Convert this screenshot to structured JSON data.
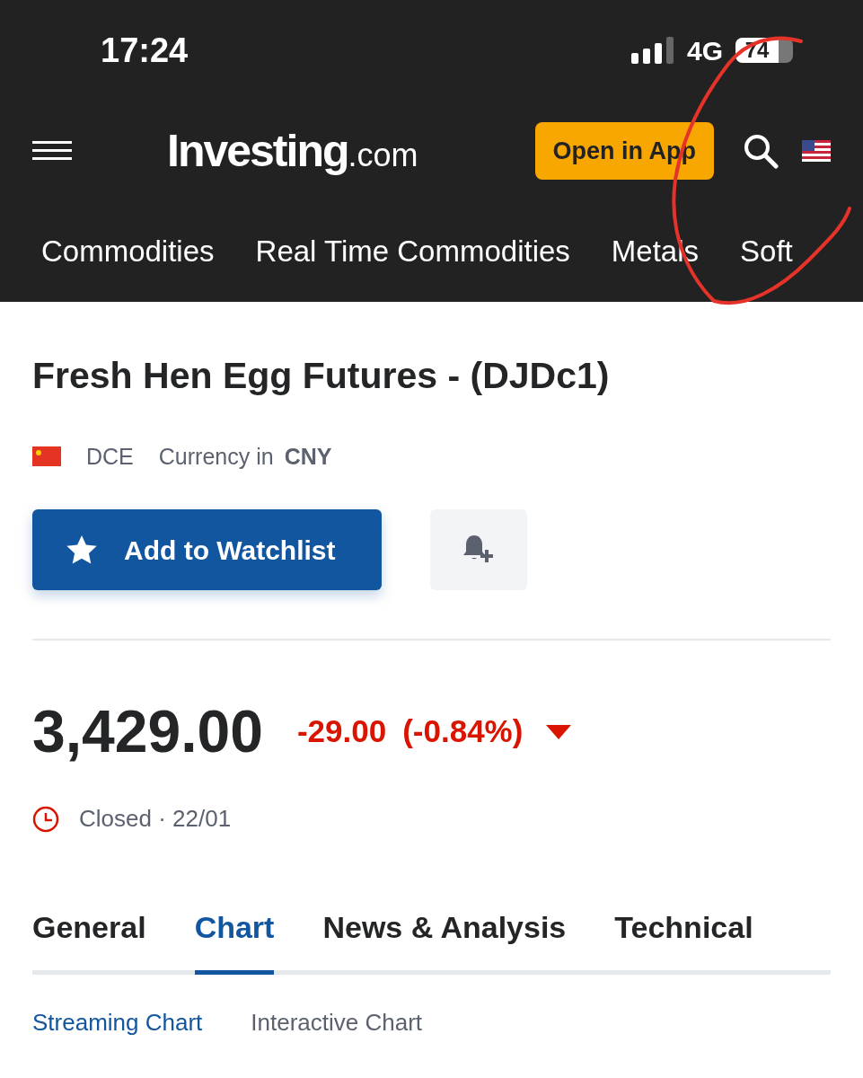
{
  "status_bar": {
    "time": "17:24",
    "network": "4G",
    "battery": "74"
  },
  "header": {
    "logo_main": "Investing",
    "logo_suffix": ".com",
    "open_app_button": "Open in App"
  },
  "nav": [
    {
      "label": "Commodities"
    },
    {
      "label": "Real Time Commodities"
    },
    {
      "label": "Metals"
    },
    {
      "label": "Soft"
    }
  ],
  "instrument": {
    "title": "Fresh Hen Egg Futures - (DJDc1)",
    "exchange": "DCE",
    "currency_label": "Currency in",
    "currency": "CNY"
  },
  "watchlist_button": "Add to Watchlist",
  "quote": {
    "price": "3,429.00",
    "change": "-29.00",
    "change_percent": "(-0.84%)",
    "falling": true,
    "status": "Closed · 22/01"
  },
  "tabs": [
    {
      "label": "General",
      "selected": false
    },
    {
      "label": "Chart",
      "selected": true
    },
    {
      "label": "News & Analysis",
      "selected": false
    },
    {
      "label": "Technical",
      "selected": false
    }
  ],
  "sub_tabs": [
    {
      "label": "Streaming Chart",
      "selected": true
    },
    {
      "label": "Interactive Chart",
      "selected": false
    }
  ]
}
